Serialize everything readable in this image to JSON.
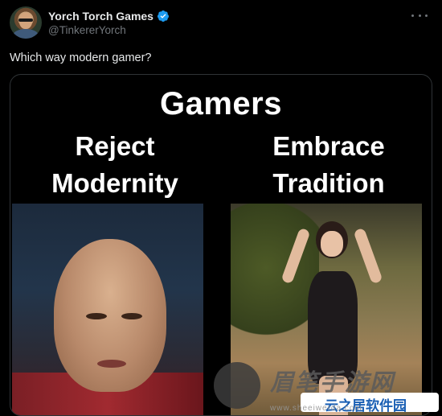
{
  "tweet": {
    "display_name": "Yorch Torch Games",
    "handle": "@TinkererYorch",
    "verified": true,
    "text": "Which way modern gamer?"
  },
  "meme": {
    "title": "Gamers",
    "left_caption": "Reject Modernity",
    "right_caption": "Embrace Tradition"
  },
  "watermark": {
    "text": "眉笔手游网",
    "badge": "云之居软件园",
    "url": "www.sheeiwerda.com"
  },
  "colors": {
    "background": "#000000",
    "text": "#e7e9ea",
    "secondary_text": "#71767b",
    "verified": "#1d9bf0"
  },
  "icons": [
    "verified-icon",
    "more-icon"
  ]
}
